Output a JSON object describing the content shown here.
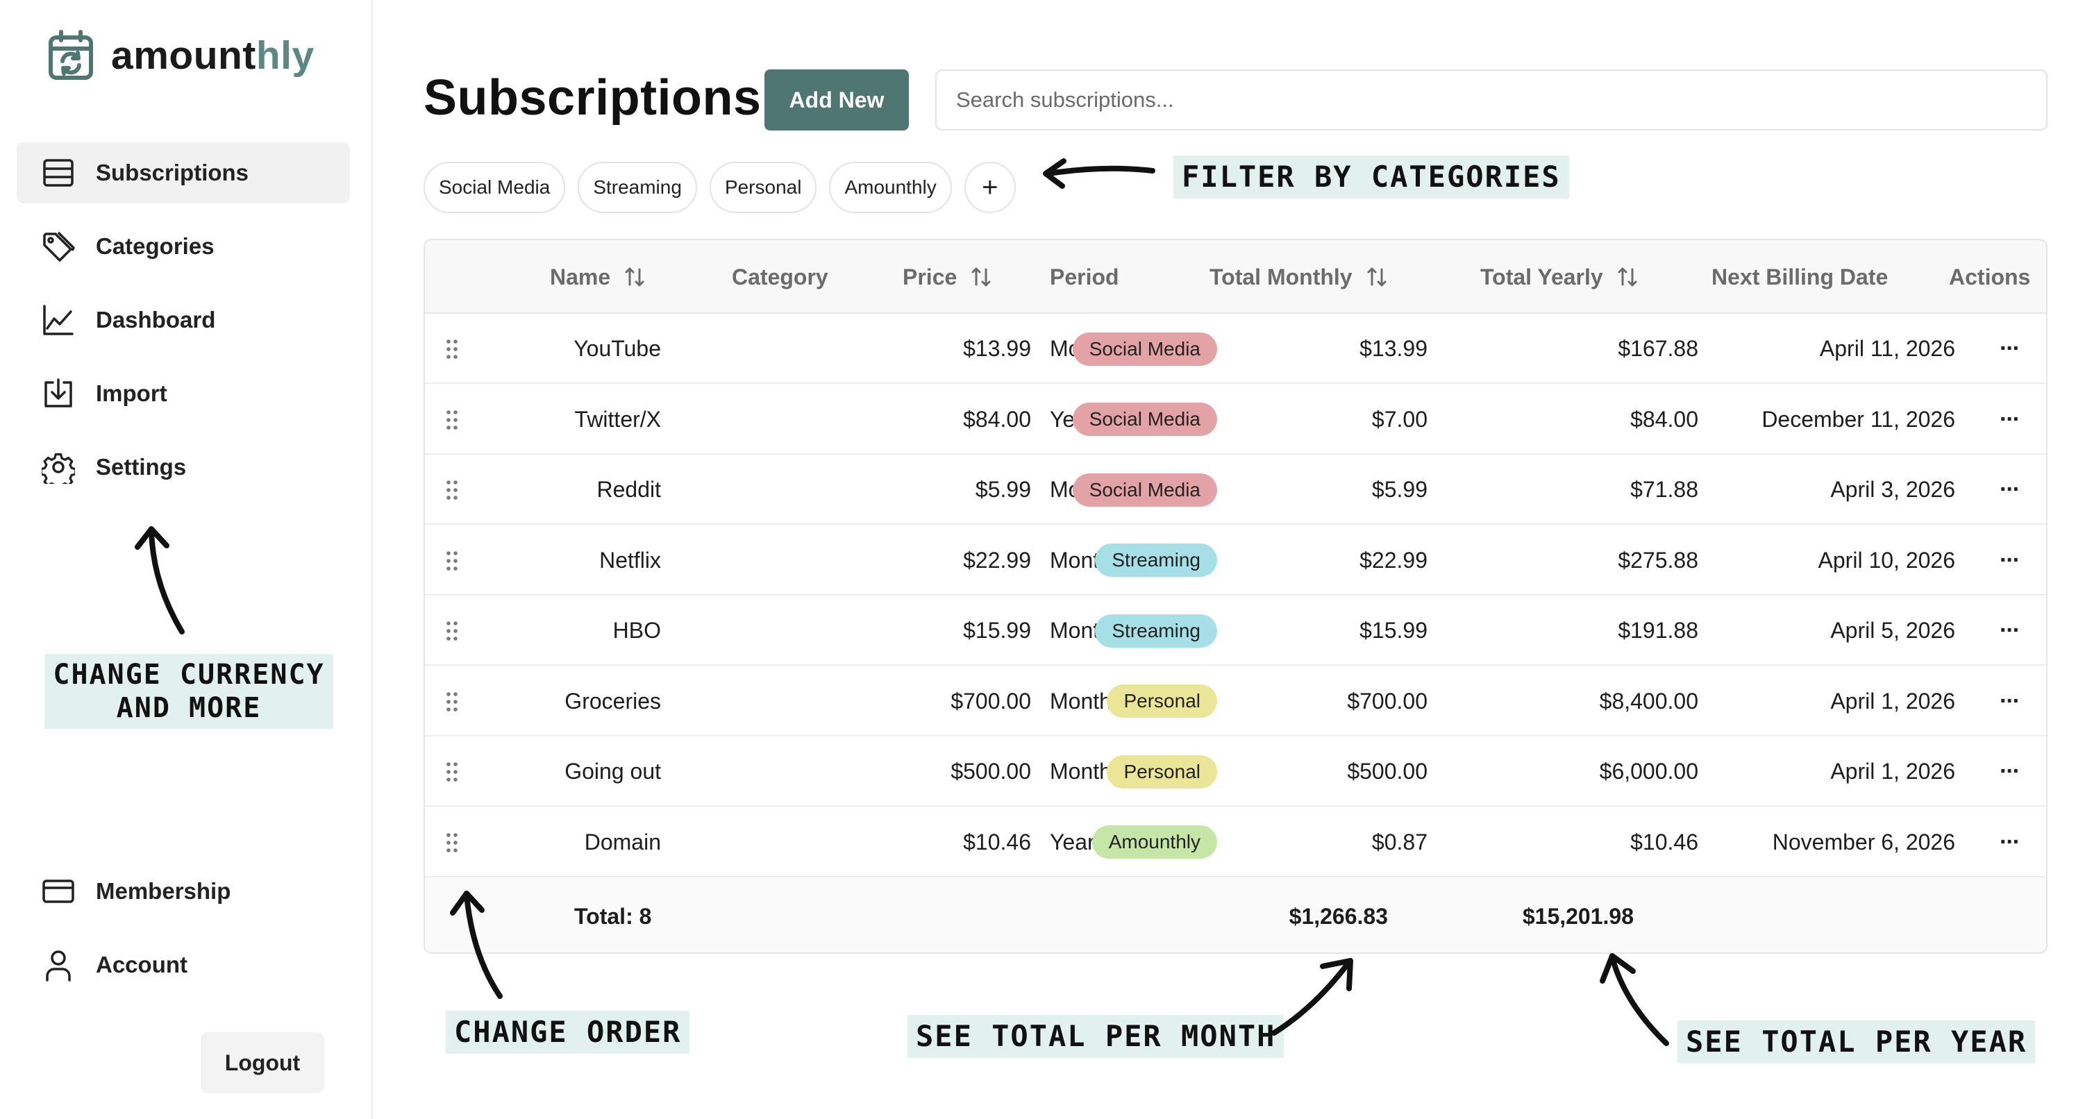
{
  "brand": {
    "name_part1": "amount",
    "name_part2": "hly",
    "accent_color": "#5d8782"
  },
  "sidebar": {
    "items": [
      {
        "label": "Subscriptions",
        "icon": "table-icon",
        "active": true
      },
      {
        "label": "Categories",
        "icon": "tag-icon",
        "active": false
      },
      {
        "label": "Dashboard",
        "icon": "chart-icon",
        "active": false
      },
      {
        "label": "Import",
        "icon": "import-icon",
        "active": false
      },
      {
        "label": "Settings",
        "icon": "gear-icon",
        "active": false
      }
    ],
    "bottom_items": [
      {
        "label": "Membership",
        "icon": "card-icon"
      },
      {
        "label": "Account",
        "icon": "user-icon"
      }
    ],
    "logout_label": "Logout"
  },
  "header": {
    "title": "Subscriptions",
    "add_label": "Add New",
    "search_placeholder": "Search subscriptions...",
    "add_button_color": "#4f7672"
  },
  "filters": {
    "chips": [
      "Social Media",
      "Streaming",
      "Personal",
      "Amounthly"
    ],
    "add_label": "+"
  },
  "table": {
    "columns": {
      "name": "Name",
      "category": "Category",
      "price": "Price",
      "period": "Period",
      "total_monthly": "Total Monthly",
      "total_yearly": "Total Yearly",
      "next_billing": "Next Billing Date",
      "actions": "Actions"
    },
    "category_colors": {
      "Social Media": "#e3a3a6",
      "Streaming": "#a6dfe6",
      "Personal": "#ebe597",
      "Amounthly": "#c5e6a6"
    },
    "rows": [
      {
        "name": "YouTube",
        "category": "Social Media",
        "price": "$13.99",
        "period": "Monthly",
        "total_monthly": "$13.99",
        "total_yearly": "$167.88",
        "next_billing": "April 11, 2026",
        "actions": "···"
      },
      {
        "name": "Twitter/X",
        "category": "Social Media",
        "price": "$84.00",
        "period": "Yearly",
        "total_monthly": "$7.00",
        "total_yearly": "$84.00",
        "next_billing": "December 11, 2026",
        "actions": "···"
      },
      {
        "name": "Reddit",
        "category": "Social Media",
        "price": "$5.99",
        "period": "Monthly",
        "total_monthly": "$5.99",
        "total_yearly": "$71.88",
        "next_billing": "April 3, 2026",
        "actions": "···"
      },
      {
        "name": "Netflix",
        "category": "Streaming",
        "price": "$22.99",
        "period": "Monthly",
        "total_monthly": "$22.99",
        "total_yearly": "$275.88",
        "next_billing": "April 10, 2026",
        "actions": "···"
      },
      {
        "name": "HBO",
        "category": "Streaming",
        "price": "$15.99",
        "period": "Monthly",
        "total_monthly": "$15.99",
        "total_yearly": "$191.88",
        "next_billing": "April 5, 2026",
        "actions": "···"
      },
      {
        "name": "Groceries",
        "category": "Personal",
        "price": "$700.00",
        "period": "Monthly",
        "total_monthly": "$700.00",
        "total_yearly": "$8,400.00",
        "next_billing": "April 1, 2026",
        "actions": "···"
      },
      {
        "name": "Going out",
        "category": "Personal",
        "price": "$500.00",
        "period": "Monthly",
        "total_monthly": "$500.00",
        "total_yearly": "$6,000.00",
        "next_billing": "April 1, 2026",
        "actions": "···"
      },
      {
        "name": "Domain",
        "category": "Amounthly",
        "price": "$10.46",
        "period": "Yearly",
        "total_monthly": "$0.87",
        "total_yearly": "$10.46",
        "next_billing": "November 6, 2026",
        "actions": "···"
      }
    ],
    "footer": {
      "total_label": "Total: 8",
      "total_monthly": "$1,266.83",
      "total_yearly": "$15,201.98"
    }
  },
  "annotations": {
    "filter": "Filter by categories",
    "currency_line1": "Change currency",
    "currency_line2": "and more",
    "order": "Change order",
    "month": "See total per month",
    "year": "See total per year"
  }
}
